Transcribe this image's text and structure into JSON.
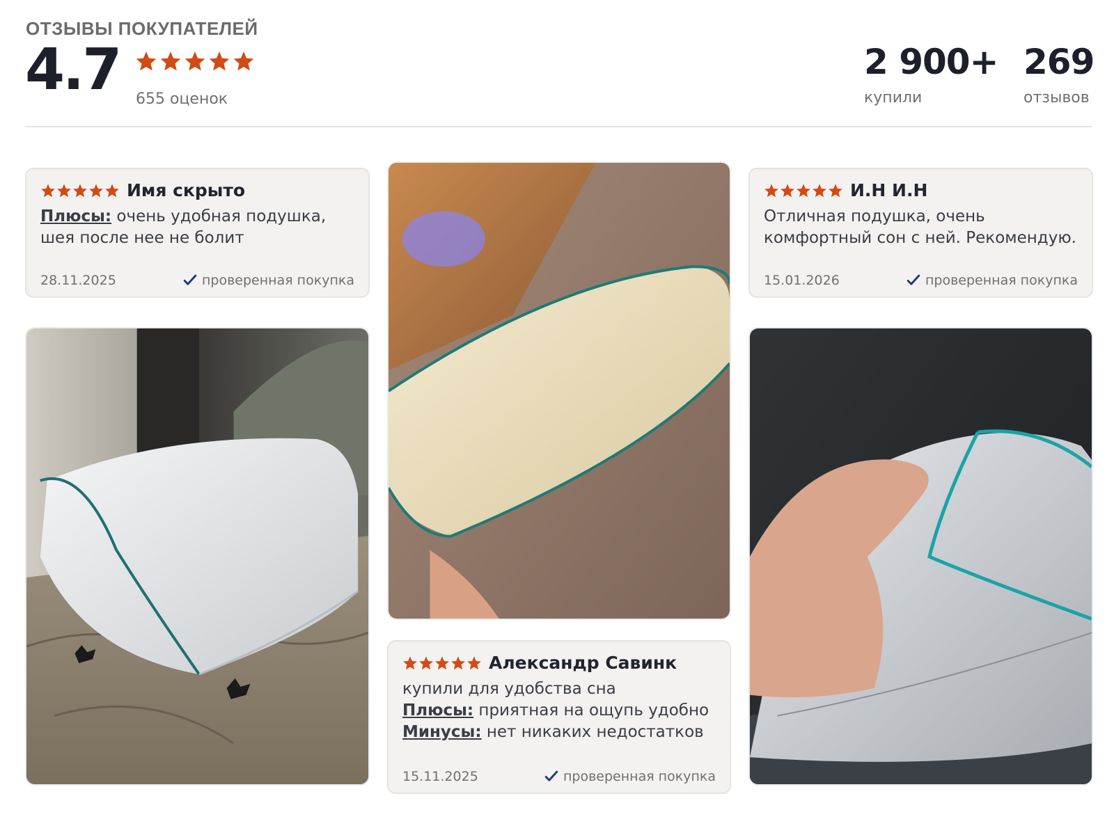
{
  "header": {
    "section_title": "ОТЗЫВЫ ПОКУПАТЕЛЕЙ",
    "rating": "4.7",
    "stars": 5,
    "ratings_count": "655 оценок",
    "bought_value": "2 900+",
    "bought_label": "купили",
    "reviews_value": "269",
    "reviews_label": "отзывов"
  },
  "colors": {
    "star": "#d24a16",
    "check": "#1f3a7a",
    "title_gray": "#6b6b6b",
    "rating_dark": "#1d1f2b"
  },
  "icons": {
    "star": "star-icon",
    "check": "checkmark-icon"
  },
  "reviews": [
    {
      "author": "Имя скрыто",
      "stars": 5,
      "pros_label": "Плюсы:",
      "pros_text": "очень удобная подушка, шея после нее не болит",
      "date": "28.11.2025",
      "verified": "проверенная покупка"
    },
    {
      "author": "И.Н И.Н",
      "stars": 5,
      "text": "Отличная подушка, очень комфортный сон с ней. Рекомендую.",
      "date": "15.01.2026",
      "verified": "проверенная покупка"
    },
    {
      "author": "Александр Савинк",
      "stars": 5,
      "text": "купили для удобства сна",
      "pros_label": "Плюсы:",
      "pros_text": "приятная на ощупь удобно",
      "cons_label": "Минусы:",
      "cons_text": "нет никаких недостатков",
      "date": "15.11.2025",
      "verified": "проверенная покупка"
    }
  ],
  "photos": [
    {
      "subject": "pillow-on-bed"
    },
    {
      "subject": "pillow-held-up"
    },
    {
      "subject": "pillow-in-hand"
    }
  ]
}
